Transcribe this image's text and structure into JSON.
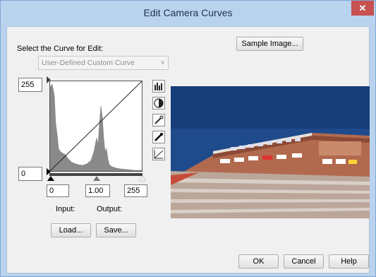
{
  "window": {
    "title": "Edit Camera Curves",
    "close_glyph": "✕"
  },
  "curve_select": {
    "label": "Select the Curve for Edit:",
    "value": "User-Defined Custom Curve"
  },
  "buttons": {
    "sample_image": "Sample Image...",
    "load": "Load...",
    "save": "Save...",
    "ok": "OK",
    "cancel": "Cancel",
    "help": "Help"
  },
  "levels": {
    "max_input": "255",
    "min_input": "0",
    "black": "0",
    "gamma": "1.00",
    "white": "255"
  },
  "labels": {
    "input": "Input:",
    "output": "Output:"
  },
  "tools": [
    "histogram-icon",
    "contrast-icon",
    "eyedropper-white-icon",
    "eyedropper-black-icon",
    "curve-reset-icon"
  ],
  "colors": {
    "title_bar": "#b9d3ee",
    "close": "#c75050",
    "histogram": "#8a8a8a",
    "sky": "#1f4a8c"
  }
}
